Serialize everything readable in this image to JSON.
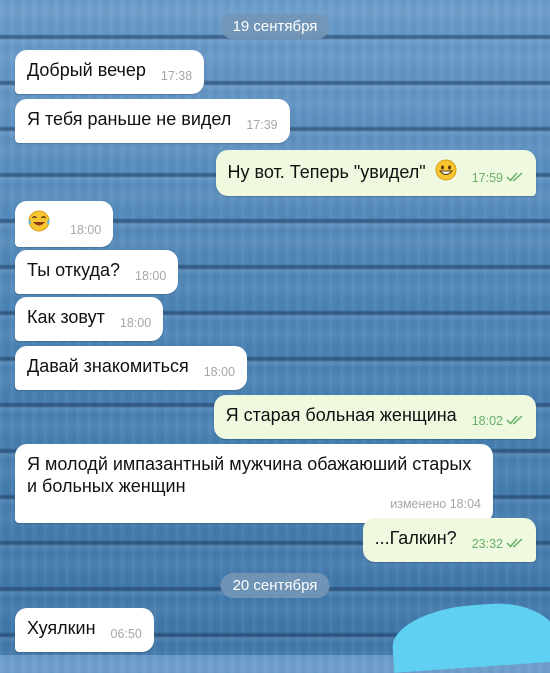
{
  "dates": {
    "first": "19 сентября",
    "second": "20 сентября"
  },
  "messages": [
    {
      "text": "Добрый вечер",
      "time": "17:38",
      "direction": "in"
    },
    {
      "text": "Я тебя раньше не видел",
      "time": "17:39",
      "direction": "in"
    },
    {
      "text": "Ну вот. Теперь \"увидел\"",
      "time": "17:59",
      "direction": "out",
      "emoji": "grinning-face",
      "status": "read"
    },
    {
      "text": "",
      "time": "18:00",
      "direction": "in",
      "emoji": "face-with-tears-of-joy"
    },
    {
      "text": "Ты откуда?",
      "time": "18:00",
      "direction": "in"
    },
    {
      "text": "Как зовут",
      "time": "18:00",
      "direction": "in"
    },
    {
      "text": "Давай знакомиться",
      "time": "18:00",
      "direction": "in"
    },
    {
      "text": "Я старая больная женщина",
      "time": "18:02",
      "direction": "out",
      "status": "read"
    },
    {
      "text": "Я молодй импазантный мужчина обажаюший старых и больных женщин",
      "edited_label": "изменено",
      "time": "18:04",
      "direction": "in"
    },
    {
      "text": "...Галкин?",
      "time": "23:32",
      "direction": "out",
      "status": "read"
    },
    {
      "text": "Хуялкин",
      "time": "06:50",
      "direction": "in"
    }
  ],
  "colors": {
    "incoming_bubble": "#ffffff",
    "outgoing_bubble": "#eef9df",
    "read_ticks": "#67b06a",
    "date_pill": "#7396b6",
    "redaction": "#5fd0f1"
  }
}
